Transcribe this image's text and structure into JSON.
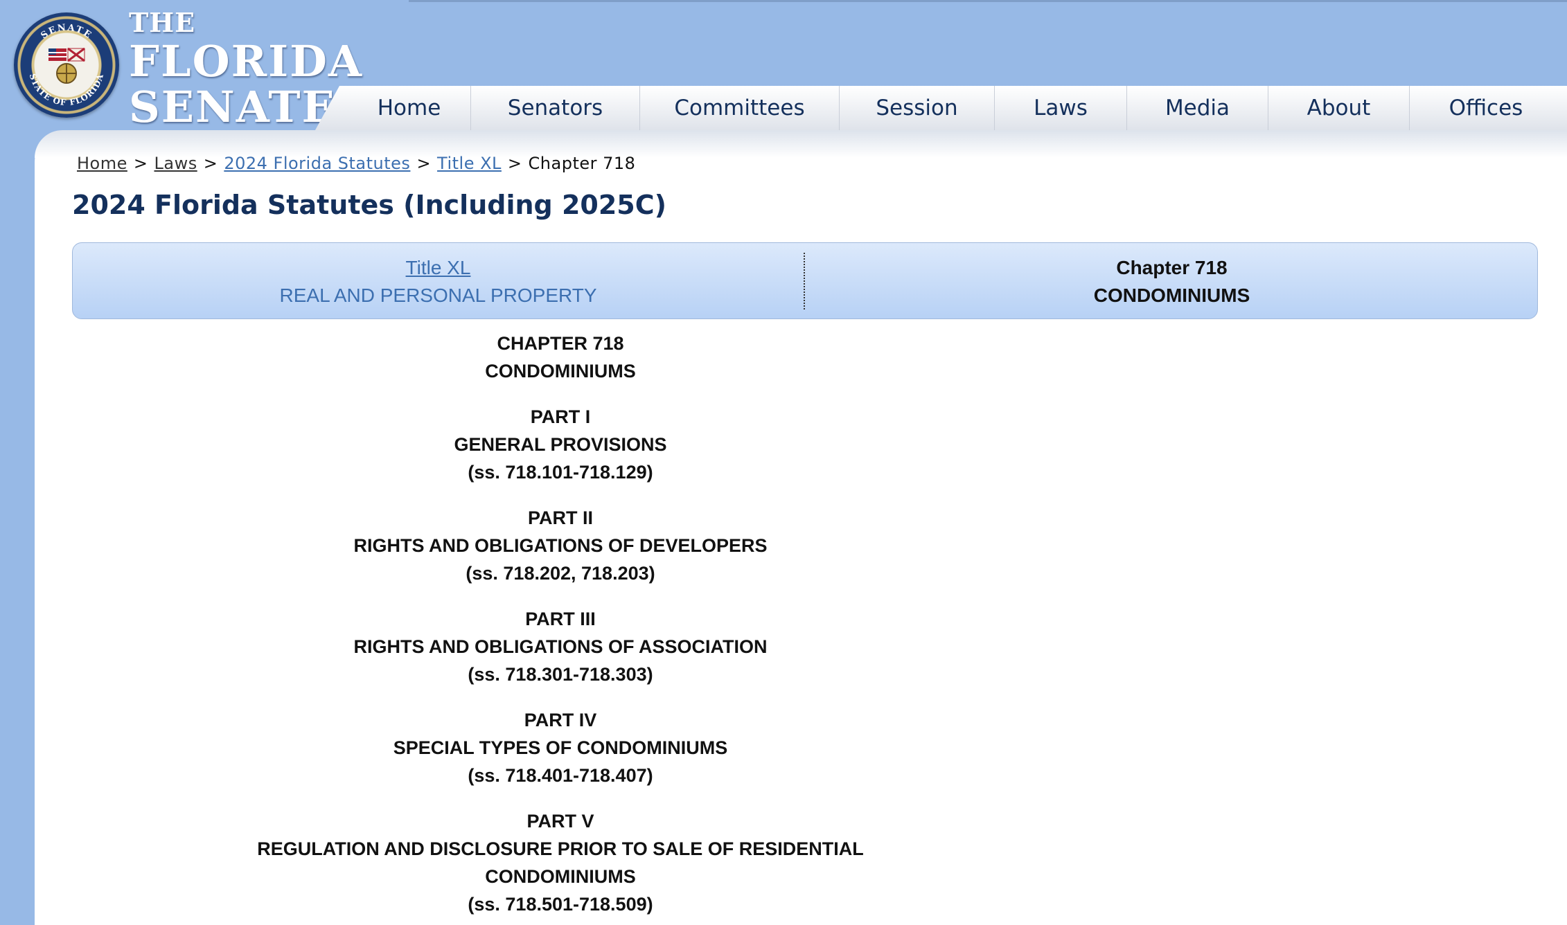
{
  "header": {
    "logo_the": "THE",
    "logo_florida": "FLORIDA",
    "logo_senate": "SENATE",
    "seal_text_top": "SENATE",
    "seal_text_bottom": "STATE OF FLORIDA"
  },
  "nav": {
    "items": [
      {
        "label": "Home"
      },
      {
        "label": "Senators"
      },
      {
        "label": "Committees"
      },
      {
        "label": "Session"
      },
      {
        "label": "Laws"
      },
      {
        "label": "Media"
      },
      {
        "label": "About"
      },
      {
        "label": "Offices"
      }
    ]
  },
  "breadcrumb": {
    "items": [
      "Home",
      "Laws",
      "2024 Florida Statutes",
      "Title XL"
    ],
    "current": "Chapter 718",
    "separator": ">"
  },
  "page_title": "2024 Florida Statutes (Including 2025C)",
  "nav_box": {
    "left_link": "Title XL",
    "left_sub": "REAL AND PERSONAL PROPERTY",
    "right_title": "Chapter 718",
    "right_sub": "CONDOMINIUMS"
  },
  "toc": {
    "chapter": "CHAPTER 718",
    "chapter_name": "CONDOMINIUMS",
    "parts": [
      {
        "part": "PART I",
        "name": "GENERAL PROVISIONS",
        "name2": "",
        "range": "(ss. 718.101-718.129)"
      },
      {
        "part": "PART II",
        "name": "RIGHTS AND OBLIGATIONS OF DEVELOPERS",
        "name2": "",
        "range": "(ss. 718.202, 718.203)"
      },
      {
        "part": "PART III",
        "name": "RIGHTS AND OBLIGATIONS OF ASSOCIATION",
        "name2": "",
        "range": "(ss. 718.301-718.303)"
      },
      {
        "part": "PART IV",
        "name": "SPECIAL TYPES OF CONDOMINIUMS",
        "name2": "",
        "range": "(ss. 718.401-718.407)"
      },
      {
        "part": "PART V",
        "name": "REGULATION AND DISCLOSURE PRIOR TO SALE OF RESIDENTIAL",
        "name2": "CONDOMINIUMS",
        "range": "(ss. 718.501-718.509)"
      }
    ]
  },
  "colors": {
    "background": "#97b9e6",
    "nav_text": "#14305c",
    "link_blue": "#3c6fb0",
    "title_navy": "#14305c"
  }
}
